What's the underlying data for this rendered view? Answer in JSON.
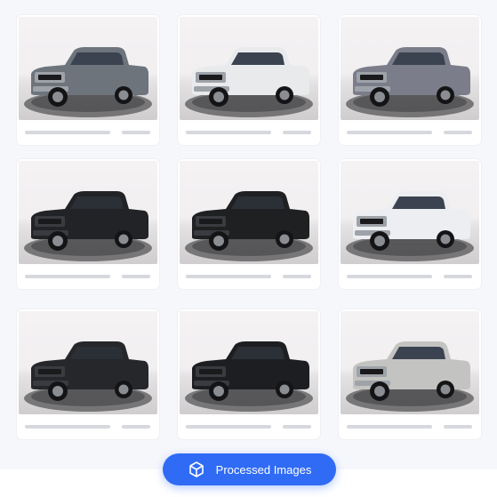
{
  "gallery": {
    "items": [
      {
        "vehicle": "gray-pickup-truck",
        "body_color": "#6d747c"
      },
      {
        "vehicle": "white-pickup-truck",
        "body_color": "#e9eaec"
      },
      {
        "vehicle": "gray-electric-suv",
        "body_color": "#7b7d8a"
      },
      {
        "vehicle": "black-heavy-duty-pickup",
        "body_color": "#222326"
      },
      {
        "vehicle": "black-midsize-pickup",
        "body_color": "#1f2022"
      },
      {
        "vehicle": "white-electric-pickup",
        "body_color": "#eceef1"
      },
      {
        "vehicle": "black-pickup-truck",
        "body_color": "#26272b"
      },
      {
        "vehicle": "black-pickup-truck",
        "body_color": "#1d1e21"
      },
      {
        "vehicle": "silver-heavy-duty-pickup",
        "body_color": "#c3c3c1"
      }
    ]
  },
  "action": {
    "label": "Processed Images",
    "icon": "cube-icon",
    "color": "#2f6bf5"
  }
}
